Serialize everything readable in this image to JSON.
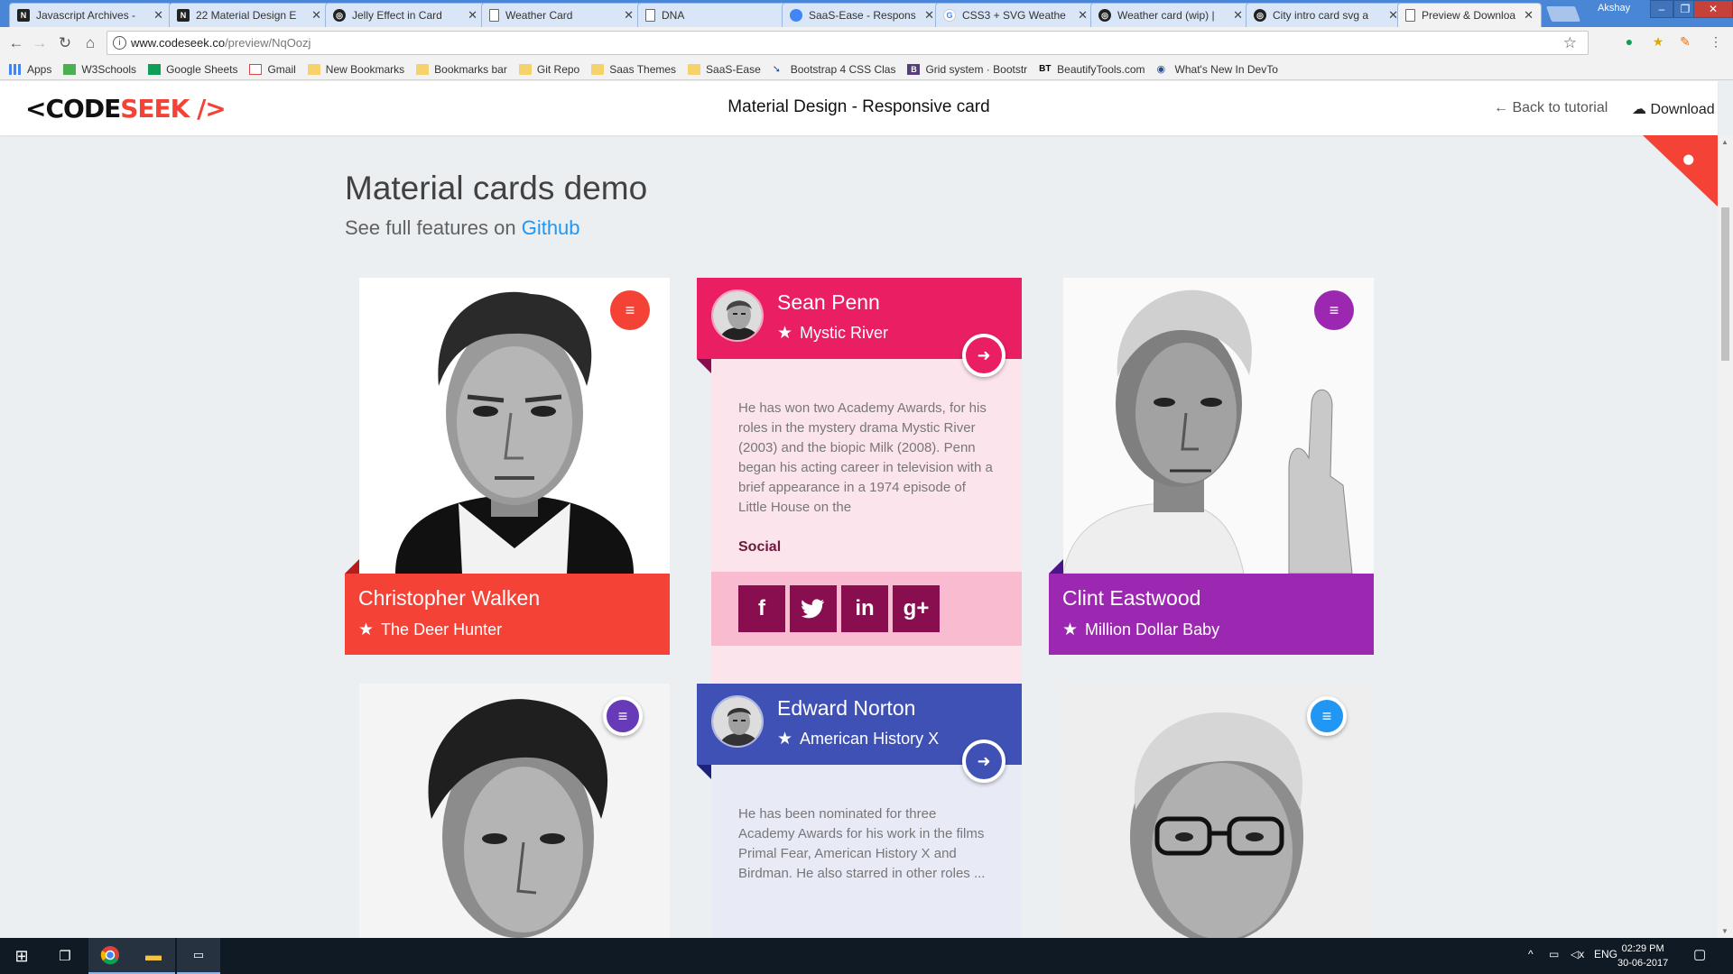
{
  "browser": {
    "tabs": [
      {
        "title": "Javascript Archives -",
        "icon": "codeseek-favicon"
      },
      {
        "title": "22 Material Design E",
        "icon": "codeseek-favicon"
      },
      {
        "title": "Jelly Effect in Card",
        "icon": "codepen-favicon"
      },
      {
        "title": "Weather Card",
        "icon": "page-favicon"
      },
      {
        "title": "DNA",
        "icon": "page-favicon"
      },
      {
        "title": "SaaS-Ease - Respons",
        "icon": "saas-favicon"
      },
      {
        "title": "CSS3 + SVG Weathe",
        "icon": "google-favicon"
      },
      {
        "title": "Weather card (wip) |",
        "icon": "codepen-favicon"
      },
      {
        "title": "City intro card svg a",
        "icon": "codepen-favicon"
      },
      {
        "title": "Preview & Downloa",
        "icon": "page-favicon"
      }
    ],
    "profile_name": "Akshay",
    "url_host": "www.codeseek.co",
    "url_path": "/preview/NqOozj",
    "bookmarks": [
      {
        "label": "Apps",
        "icon": "apps"
      },
      {
        "label": "W3Schools",
        "icon": "w3"
      },
      {
        "label": "Google Sheets",
        "icon": "sheet"
      },
      {
        "label": "Gmail",
        "icon": "gmail"
      },
      {
        "label": "New Bookmarks",
        "icon": "folder"
      },
      {
        "label": "Bookmarks bar",
        "icon": "folder"
      },
      {
        "label": "Git Repo",
        "icon": "folder"
      },
      {
        "label": "Saas Themes",
        "icon": "folder"
      },
      {
        "label": "SaaS-Ease",
        "icon": "folder"
      },
      {
        "label": "Bootstrap 4 CSS Clas",
        "icon": "arrow"
      },
      {
        "label": "Grid system · Bootstr",
        "icon": "bs"
      },
      {
        "label": "BeautifyTools.com",
        "icon": "bt"
      },
      {
        "label": "What's New In DevTo",
        "icon": "chrome"
      }
    ]
  },
  "site": {
    "logo_lt": "<",
    "logo_code": "CODE",
    "logo_seek": "SEEK",
    "logo_end": "/>",
    "page_title": "Material Design - Responsive card",
    "back_link": "Back to tutorial",
    "download_link": "Download",
    "colors": {
      "brand_red": "#f44336"
    }
  },
  "demo": {
    "title": "Material cards demo",
    "subtitle_prefix": "See full features on",
    "subtitle_link": "Github"
  },
  "cards": [
    {
      "name": "Christopher Walken",
      "movie": "The Deer Hunter",
      "color": "#f44336",
      "dark": "#b71c1c",
      "state": "closed"
    },
    {
      "name": "Sean Penn",
      "movie": "Mystic River",
      "color": "#e91e63",
      "dark": "#880e4f",
      "state": "open",
      "bio": "He has won two Academy Awards, for his roles in the mystery drama Mystic River (2003) and the biopic Milk (2008). Penn began his acting career in television with a brief appearance in a 1974 episode of Little House on the",
      "social_label": "Social",
      "social": [
        "f",
        "twitter-icon",
        "in",
        "g+"
      ]
    },
    {
      "name": "Clint Eastwood",
      "movie": "Million Dollar Baby",
      "color": "#9c27b0",
      "dark": "#4a148c",
      "state": "closed"
    },
    {
      "name": "",
      "movie": "",
      "color": "#673ab7",
      "state": "closed"
    },
    {
      "name": "Edward Norton",
      "movie": "American History X",
      "color": "#3f51b5",
      "dark": "#1a237e",
      "state": "open",
      "bio": "He has been nominated for three Academy Awards for his work in the films Primal Fear, American History X and Birdman. He also starred in other roles ..."
    },
    {
      "name": "",
      "movie": "",
      "color": "#2196f3",
      "state": "closed"
    }
  ],
  "taskbar": {
    "language": "ENG",
    "time": "02:29 PM",
    "date": "30-06-2017"
  }
}
